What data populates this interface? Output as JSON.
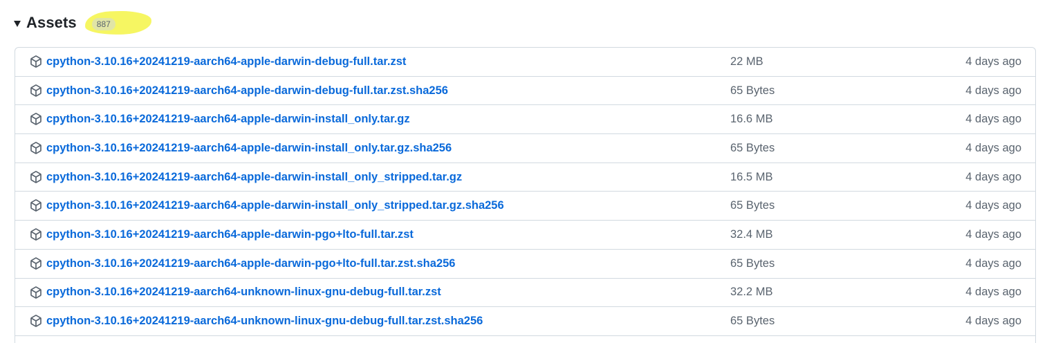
{
  "header": {
    "title": "Assets",
    "count": "887",
    "highlight_color": "#f6f65a"
  },
  "colors": {
    "link": "#0969da",
    "muted": "#59636e",
    "border": "#d1d9e0"
  },
  "assets": [
    {
      "name": "cpython-3.10.16+20241219-aarch64-apple-darwin-debug-full.tar.zst",
      "size": "22 MB",
      "date": "4 days ago",
      "icon": "package-icon"
    },
    {
      "name": "cpython-3.10.16+20241219-aarch64-apple-darwin-debug-full.tar.zst.sha256",
      "size": "65 Bytes",
      "date": "4 days ago",
      "icon": "package-icon"
    },
    {
      "name": "cpython-3.10.16+20241219-aarch64-apple-darwin-install_only.tar.gz",
      "size": "16.6 MB",
      "date": "4 days ago",
      "icon": "package-icon"
    },
    {
      "name": "cpython-3.10.16+20241219-aarch64-apple-darwin-install_only.tar.gz.sha256",
      "size": "65 Bytes",
      "date": "4 days ago",
      "icon": "package-icon"
    },
    {
      "name": "cpython-3.10.16+20241219-aarch64-apple-darwin-install_only_stripped.tar.gz",
      "size": "16.5 MB",
      "date": "4 days ago",
      "icon": "package-icon"
    },
    {
      "name": "cpython-3.10.16+20241219-aarch64-apple-darwin-install_only_stripped.tar.gz.sha256",
      "size": "65 Bytes",
      "date": "4 days ago",
      "icon": "package-icon"
    },
    {
      "name": "cpython-3.10.16+20241219-aarch64-apple-darwin-pgo+lto-full.tar.zst",
      "size": "32.4 MB",
      "date": "4 days ago",
      "icon": "package-icon"
    },
    {
      "name": "cpython-3.10.16+20241219-aarch64-apple-darwin-pgo+lto-full.tar.zst.sha256",
      "size": "65 Bytes",
      "date": "4 days ago",
      "icon": "package-icon"
    },
    {
      "name": "cpython-3.10.16+20241219-aarch64-unknown-linux-gnu-debug-full.tar.zst",
      "size": "32.2 MB",
      "date": "4 days ago",
      "icon": "package-icon"
    },
    {
      "name": "cpython-3.10.16+20241219-aarch64-unknown-linux-gnu-debug-full.tar.zst.sha256",
      "size": "65 Bytes",
      "date": "4 days ago",
      "icon": "package-icon"
    }
  ]
}
